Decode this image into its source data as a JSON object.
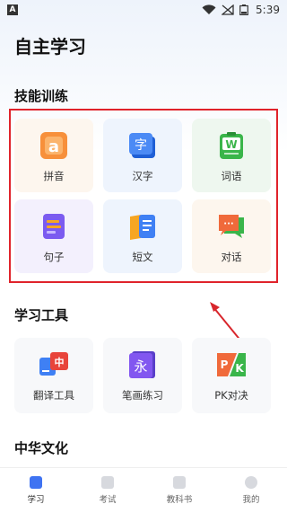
{
  "status": {
    "time": "5:39",
    "left_icon": "A"
  },
  "page_title": "自主学习",
  "sections": {
    "skills": "技能训练",
    "tools": "学习工具",
    "culture": "中华文化"
  },
  "skills": [
    {
      "label": "拼音",
      "icon": "pinyin-icon",
      "bg": "#fdf6ee",
      "color": "#f7903b",
      "glyph": "a"
    },
    {
      "label": "汉字",
      "icon": "hanzi-icon",
      "bg": "#eef4fd",
      "color": "#3f80f4",
      "glyph": "字"
    },
    {
      "label": "词语",
      "icon": "ciyu-icon",
      "bg": "#eef7ef",
      "color": "#3ab54a",
      "glyph": "W"
    },
    {
      "label": "句子",
      "icon": "juzi-icon",
      "bg": "#f3f0fd",
      "color": "#7b5bf0",
      "glyph": ""
    },
    {
      "label": "短文",
      "icon": "duanwen-icon",
      "bg": "#eef4fd",
      "color": "#3f80f4",
      "glyph": ""
    },
    {
      "label": "对话",
      "icon": "duihua-icon",
      "bg": "#fdf6ee",
      "color": "#f06a3b",
      "glyph": "···"
    }
  ],
  "tools": [
    {
      "label": "翻译工具",
      "icon": "translate-icon",
      "glyph": "中"
    },
    {
      "label": "笔画练习",
      "icon": "stroke-icon",
      "glyph": "永"
    },
    {
      "label": "PK对决",
      "icon": "pk-icon",
      "glyph": "P/K"
    }
  ],
  "tabs": [
    {
      "label": "学习",
      "icon": "study-tab-icon",
      "active": true
    },
    {
      "label": "考试",
      "icon": "exam-tab-icon",
      "active": false
    },
    {
      "label": "教科书",
      "icon": "textbook-tab-icon",
      "active": false
    },
    {
      "label": "我的",
      "icon": "profile-tab-icon",
      "active": false
    }
  ],
  "colors": {
    "accent": "#3f73f2",
    "highlight": "#e0232b",
    "arrow": "#d8262c"
  }
}
